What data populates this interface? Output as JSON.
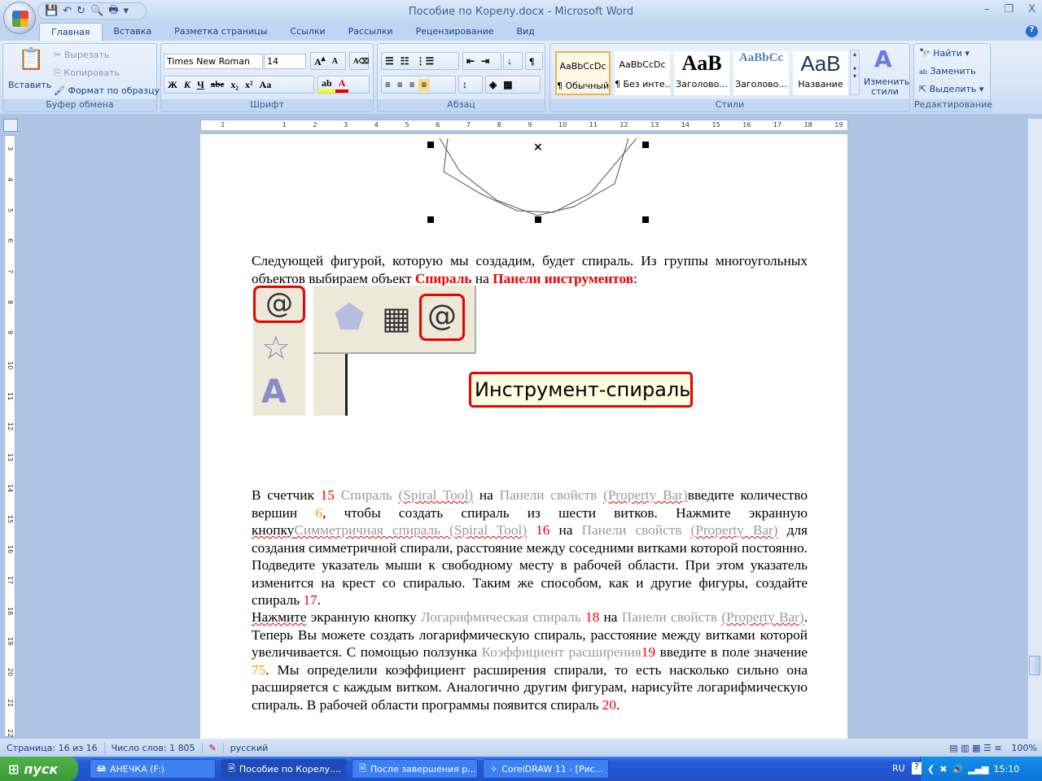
{
  "window": {
    "title": "Пособие по Корелу.docx - Microsoft Word",
    "min": "–",
    "max": "❐",
    "close": "X"
  },
  "qat": [
    "save-icon",
    "undo-icon",
    "redo-icon",
    "print-preview-icon",
    "print-icon"
  ],
  "tabs": [
    "Главная",
    "Вставка",
    "Разметка страницы",
    "Ссылки",
    "Рассылки",
    "Рецензирование",
    "Вид"
  ],
  "clipboard": {
    "paste": "Вставить",
    "cut": "Вырезать",
    "copy": "Копировать",
    "format": "Формат по образцу",
    "label": "Буфер обмена"
  },
  "font": {
    "name": "Times New Roman",
    "size": "14",
    "label": "Шрифт",
    "bold": "Ж",
    "italic": "К",
    "underline": "Ч",
    "strike": "abe",
    "sub": "x₂",
    "sup": "x²",
    "case": "Aa"
  },
  "paragraph": {
    "label": "Абзац"
  },
  "styles": {
    "label": "Стили",
    "items": [
      {
        "sample": "AaBbCcDc",
        "name": "¶ Обычный"
      },
      {
        "sample": "AaBbCcDc",
        "name": "¶ Без инте..."
      },
      {
        "sample": "AaB",
        "name": "Заголово..."
      },
      {
        "sample": "AaBbCc",
        "name": "Заголово..."
      },
      {
        "sample": "AaB",
        "name": "Название"
      }
    ],
    "change": "Изменить стили"
  },
  "editing": {
    "find": "Найти",
    "replace": "Заменить",
    "select": "Выделить",
    "label": "Редактирование"
  },
  "doc": {
    "p1": [
      {
        "t": "Следующей фигурой, которую мы создадим, будет спираль. Из группы многоугольных объектов выбираем объект "
      },
      {
        "t": "Спираль",
        "c": "rb"
      },
      {
        "t": "  на "
      },
      {
        "t": "Панели инструментов",
        "c": "rb"
      },
      {
        "t": ":"
      }
    ],
    "tooltip": "Инструмент-спираль",
    "p2": [
      {
        "t": "В  счетчик "
      },
      {
        "t": "15",
        "c": "r"
      },
      {
        "t": " Спираль  ",
        "c": "g"
      },
      {
        "t": "(Spiral  Tool)",
        "c": "g u"
      },
      {
        "t": " на "
      },
      {
        "t": "Панели  свойств  ",
        "c": "g"
      },
      {
        "t": "(Property  Bar)",
        "c": "g u"
      },
      {
        "t": "введите количество вершин "
      },
      {
        "t": "6",
        "c": "o"
      },
      {
        "t": ", чтобы создать спираль из шести витков. Нажмите экранную "
      },
      {
        "t": "кнопку",
        "c": "u"
      },
      {
        "t": "Симметричная спираль ",
        "c": "g u"
      },
      {
        "t": "(Spiral Tool)",
        "c": "g u"
      },
      {
        "t": " "
      },
      {
        "t": "16",
        "c": "r"
      },
      {
        "t": " на "
      },
      {
        "t": "Панели свойств ",
        "c": "g"
      },
      {
        "t": "(Property Bar)",
        "c": "g u"
      },
      {
        "t": " для создания симметричной спирали, расстояние между соседними витками которой постоянно. Подведите указатель мыши к свободному месту в рабочей области. При этом указатель изменится на крест со спиралью. Таким же способом, как и другие фигуры, создайте спираль "
      },
      {
        "t": "17",
        "c": "r"
      },
      {
        "t": "."
      }
    ],
    "p3": [
      {
        "t": " "
      },
      {
        "t": "Нажмите",
        "c": "u"
      },
      {
        "t": "  экранную  кнопку "
      },
      {
        "t": "Логарифмическая  спираль ",
        "c": "g"
      },
      {
        "t": "18",
        "c": "r"
      },
      {
        "t": " на "
      },
      {
        "t": "Панели  свойств ",
        "c": "g"
      },
      {
        "t": "(Property Bar)",
        "c": "g u"
      },
      {
        "t": ". Теперь Вы можете создать логарифмическую спираль, расстояние между витками которой увеличивается. С помощью ползунка "
      },
      {
        "t": "Коэффициент расширения",
        "c": "g"
      },
      {
        "t": "19",
        "c": "r"
      },
      {
        "t": " введите в поле значение "
      },
      {
        "t": "75",
        "c": "o"
      },
      {
        "t": ". Мы определили коэффициент расширения спирали, то есть насколько сильно она расширяется с каждым витком. Аналогично другим фигурам, нарисуйте логарифмическую спираль. В рабочей области программы появится спираль "
      },
      {
        "t": "20",
        "c": "r"
      },
      {
        "t": "."
      }
    ]
  },
  "status": {
    "page": "Страница: 16 из 16",
    "words": "Число слов: 1 805",
    "lang": "русский",
    "zoom": "100%"
  },
  "taskbar": {
    "start": "пуск",
    "tasks": [
      "АНЕЧКА (F:)",
      "Пособие по Корелу....",
      "После завершения р...",
      "CorelDRAW 11 - [Рис..."
    ],
    "active": 1,
    "lang": "RU",
    "clock": "15:10"
  },
  "colors": {
    "accent": "#15428b",
    "red": "#ee0000",
    "orange": "#ff9900",
    "gray": "#9a9a9a"
  }
}
